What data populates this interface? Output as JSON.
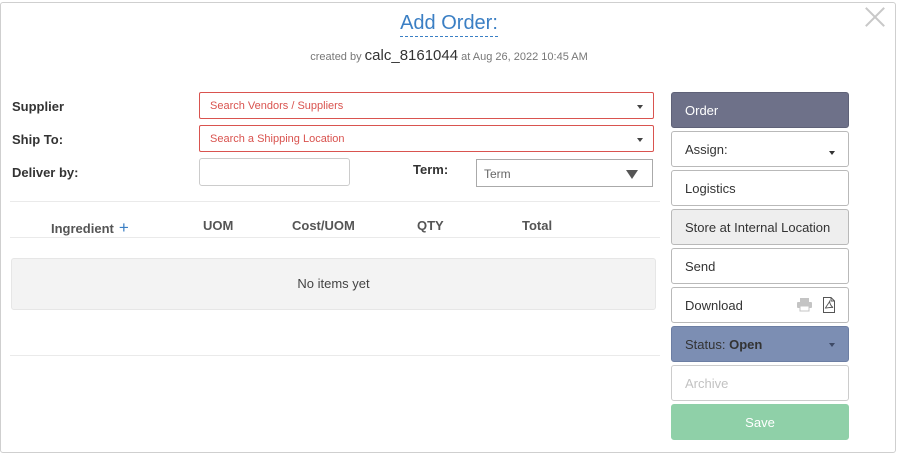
{
  "header": {
    "title": "Add Order:",
    "created_prefix": "created by",
    "created_user": "calc_8161044",
    "created_at": "at Aug 26, 2022 10:45 AM"
  },
  "form": {
    "supplier_label": "Supplier",
    "supplier_placeholder": "Search Vendors / Suppliers",
    "ship_to_label": "Ship To:",
    "ship_to_placeholder": "Search a Shipping Location",
    "deliver_by_label": "Deliver by:",
    "deliver_by_value": "",
    "term_label": "Term:",
    "term_value": "Term"
  },
  "table": {
    "columns": [
      "Ingredient",
      "UOM",
      "Cost/UOM",
      "QTY",
      "Total"
    ],
    "add_symbol": "+",
    "empty_text": "No items yet"
  },
  "sidebar": {
    "order": "Order",
    "assign": "Assign:",
    "logistics": "Logistics",
    "store_internal": "Store at Internal Location",
    "send": "Send",
    "download": "Download",
    "status_label": "Status:",
    "status_value": "Open",
    "archive": "Archive",
    "save": "Save"
  },
  "colors": {
    "title_blue": "#3b7fc4",
    "required_red": "#d9534f",
    "order_button": "#6e7189",
    "status_button": "#7c8eb3",
    "save_button": "#8fd0a8"
  },
  "icons": [
    "close-icon",
    "add-ingredient-icon",
    "print-icon",
    "pdf-icon",
    "caret-down-icon"
  ]
}
